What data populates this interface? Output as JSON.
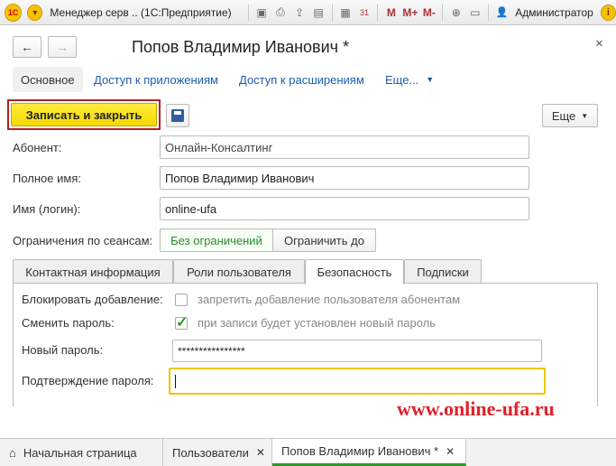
{
  "titlebar": {
    "app_title": "Менеджер серв .. (1С:Предприятие)",
    "m_label": "M",
    "m_plus_label": "M+",
    "m_minus_label": "M-",
    "calendar_day": "31",
    "user": "Администратор"
  },
  "form": {
    "title": "Попов Владимир Иванович *",
    "back_icon": "←",
    "forward_icon": "→",
    "close_icon": "×"
  },
  "section_tabs": [
    {
      "label": "Основное"
    },
    {
      "label": "Доступ к приложениям"
    },
    {
      "label": "Доступ к расширениям"
    },
    {
      "label": "Еще..."
    }
  ],
  "toolbar": {
    "save_close_label": "Записать и закрыть",
    "more_label": "Еще"
  },
  "fields": {
    "subscriber_label": "Абонент:",
    "subscriber_value": "Онлайн-Консалтинг",
    "full_name_label": "Полное имя:",
    "full_name_value": "Попов Владимир Иванович",
    "login_label": "Имя (логин):",
    "login_value": "online-ufa",
    "session_limit_label": "Ограничения по сеансам:",
    "no_limit_label": "Без ограничений",
    "limit_until_label": "Ограничить до"
  },
  "inner_tabs": [
    {
      "label": "Контактная информация"
    },
    {
      "label": "Роли пользователя"
    },
    {
      "label": "Безопасность"
    },
    {
      "label": "Подписки"
    }
  ],
  "security": {
    "block_add_label": "Блокировать добавление:",
    "block_add_text": "запретить добавление пользователя абонентам",
    "block_add_checked": false,
    "change_password_label": "Сменить пароль:",
    "change_password_text": "при записи будет установлен новый пароль",
    "change_password_checked": true,
    "new_password_label": "Новый пароль:",
    "new_password_value": "****************",
    "confirm_password_label": "Подтверждение пароля:",
    "confirm_password_value": ""
  },
  "watermark": "www.online-ufa.ru",
  "bottom_tabs": [
    {
      "label": "Начальная страница"
    },
    {
      "label": "Пользователи"
    },
    {
      "label": "Попов Владимир Иванович *"
    }
  ],
  "colors": {
    "primary_button": "#f5d800",
    "active_tab_underline": "#2a9a2a",
    "link": "#1a5dad",
    "watermark": "#e0202a"
  }
}
